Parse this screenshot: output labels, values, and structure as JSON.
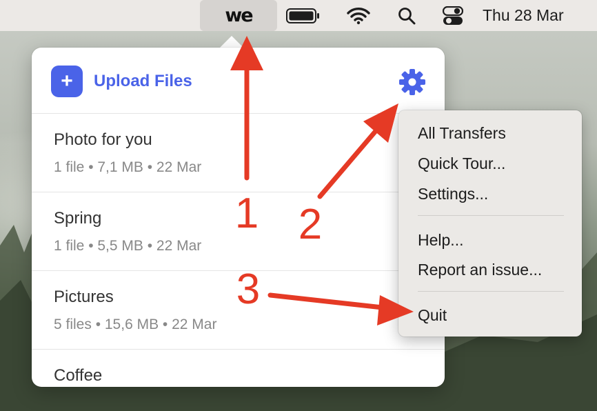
{
  "menubar": {
    "app_logo": "we",
    "icons": [
      "battery-icon",
      "wifi-icon",
      "search-icon",
      "control-center-icon"
    ],
    "clock": "Thu 28 Mar"
  },
  "popover": {
    "upload_label": "Upload Files",
    "upload_icon": "plus-icon",
    "settings_icon": "gear-icon",
    "transfers": [
      {
        "name": "Photo for you",
        "meta": "1 file • 7,1 MB • 22 Mar"
      },
      {
        "name": "Spring",
        "meta": "1 file • 5,5 MB • 22 Mar"
      },
      {
        "name": "Pictures",
        "meta": "5 files • 15,6 MB • 22 Mar"
      },
      {
        "name": "Coffee",
        "meta": ""
      }
    ]
  },
  "context_menu": {
    "items": [
      "All Transfers",
      "Quick Tour...",
      "Settings...",
      "Help...",
      "Report an issue...",
      "Quit"
    ]
  },
  "annotations": {
    "labels": [
      "1",
      "2",
      "3"
    ],
    "color": "#e53a25"
  },
  "colors": {
    "accent": "#4a63e8",
    "menubar": "#ece9e6",
    "annotation": "#e53a25"
  }
}
